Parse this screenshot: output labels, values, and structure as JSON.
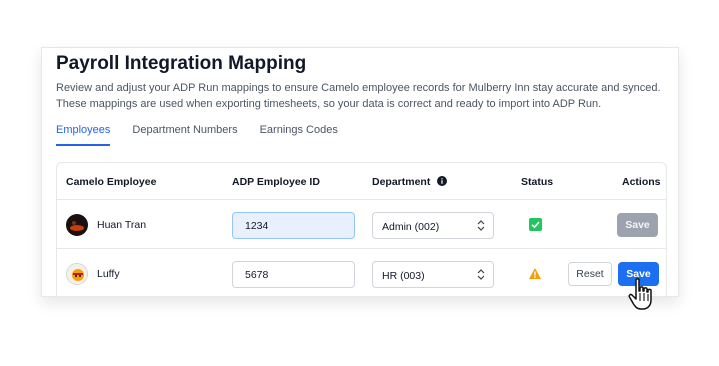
{
  "page": {
    "title": "Payroll Integration Mapping",
    "description": "Review and adjust your ADP Run mappings to ensure Camelo employee records for Mulberry Inn stay accurate and synced. These mappings are used when exporting timesheets, so your data is correct and ready to import into ADP Run."
  },
  "tabs": [
    {
      "label": "Employees",
      "active": true
    },
    {
      "label": "Department Numbers",
      "active": false
    },
    {
      "label": "Earnings Codes",
      "active": false
    }
  ],
  "table": {
    "headers": {
      "employee": "Camelo Employee",
      "adp_id": "ADP Employee ID",
      "department": "Department",
      "status": "Status",
      "actions": "Actions"
    },
    "rows": [
      {
        "name": "Huan Tran",
        "adp_id": "1234",
        "department": "Admin (002)",
        "status": "synced",
        "status_icon": "check-square-icon",
        "save_label": "Save",
        "save_enabled": false
      },
      {
        "name": "Luffy",
        "adp_id": "5678",
        "department": "HR (003)",
        "status": "warning",
        "status_icon": "warning-triangle-icon",
        "reset_label": "Reset",
        "save_label": "Save",
        "save_enabled": true
      }
    ]
  },
  "colors": {
    "accent": "#2563eb",
    "primary_button": "#1d6ff2",
    "success": "#22c55e",
    "warning": "#f59e0b",
    "disabled": "#9ca3af"
  }
}
